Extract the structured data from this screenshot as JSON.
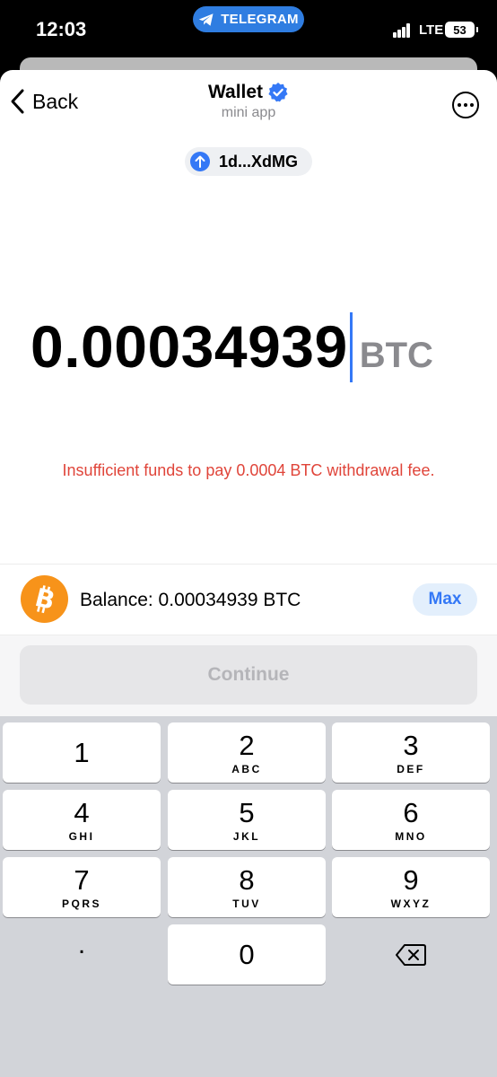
{
  "status_bar": {
    "time": "12:03",
    "app_pill": "TELEGRAM",
    "network": "LTE",
    "battery": "53"
  },
  "header": {
    "back_label": "Back",
    "title": "Wallet",
    "subtitle": "mini app"
  },
  "address_chip": {
    "label": "1d...XdMG"
  },
  "amount": {
    "value": "0.00034939",
    "currency": "BTC",
    "error": "Insufficient funds to pay 0.0004 BTC withdrawal fee."
  },
  "balance": {
    "text": "Balance: 0.00034939 BTC",
    "max_label": "Max"
  },
  "continue_label": "Continue",
  "keypad": {
    "keys": [
      {
        "num": "1",
        "letters": ""
      },
      {
        "num": "2",
        "letters": "ABC"
      },
      {
        "num": "3",
        "letters": "DEF"
      },
      {
        "num": "4",
        "letters": "GHI"
      },
      {
        "num": "5",
        "letters": "JKL"
      },
      {
        "num": "6",
        "letters": "MNO"
      },
      {
        "num": "7",
        "letters": "PQRS"
      },
      {
        "num": "8",
        "letters": "TUV"
      },
      {
        "num": "9",
        "letters": "WXYZ"
      },
      {
        "num": ".",
        "letters": ""
      },
      {
        "num": "0",
        "letters": ""
      }
    ]
  },
  "colors": {
    "accent": "#3478f6",
    "error": "#e0453a",
    "bitcoin": "#f7931a"
  }
}
